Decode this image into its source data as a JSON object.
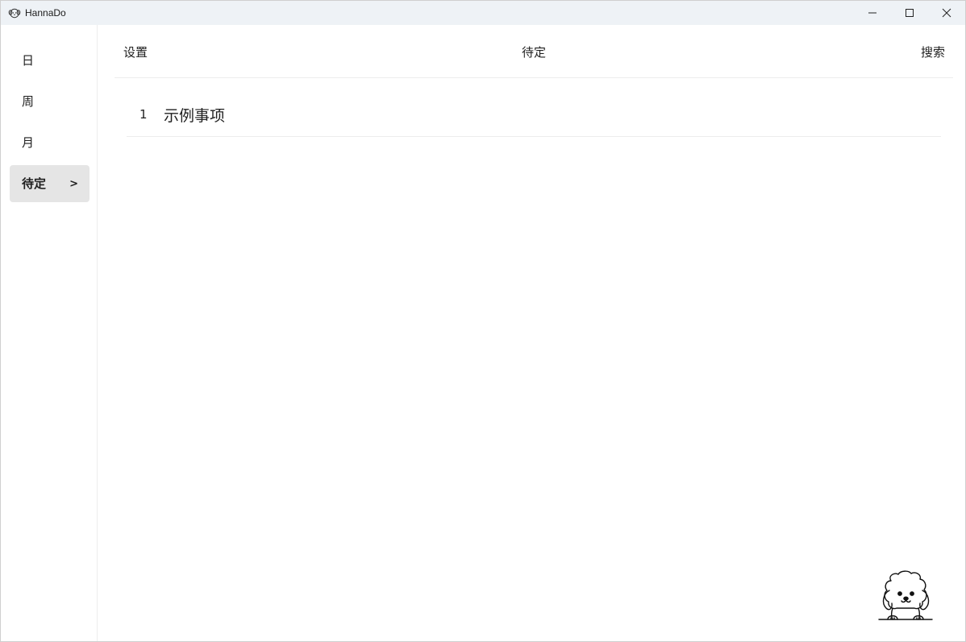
{
  "window": {
    "title": "HannaDo",
    "app_icon": "dog-face-icon",
    "controls": {
      "minimize": "minimize-icon",
      "maximize": "maximize-icon",
      "close": "close-icon"
    }
  },
  "sidebar": {
    "items": [
      {
        "label": "日",
        "active": false
      },
      {
        "label": "周",
        "active": false
      },
      {
        "label": "月",
        "active": false
      },
      {
        "label": "待定",
        "active": true,
        "indicator": ">"
      }
    ]
  },
  "header": {
    "left": "设置",
    "center": "待定",
    "right": "搜索"
  },
  "tasks": [
    {
      "number": "1",
      "title": "示例事项"
    }
  ],
  "mascot": "dog-mascot-icon",
  "colors": {
    "titlebar_bg": "#eef2f6",
    "active_nav_bg": "#e5e5e5",
    "divider": "#ececec"
  }
}
